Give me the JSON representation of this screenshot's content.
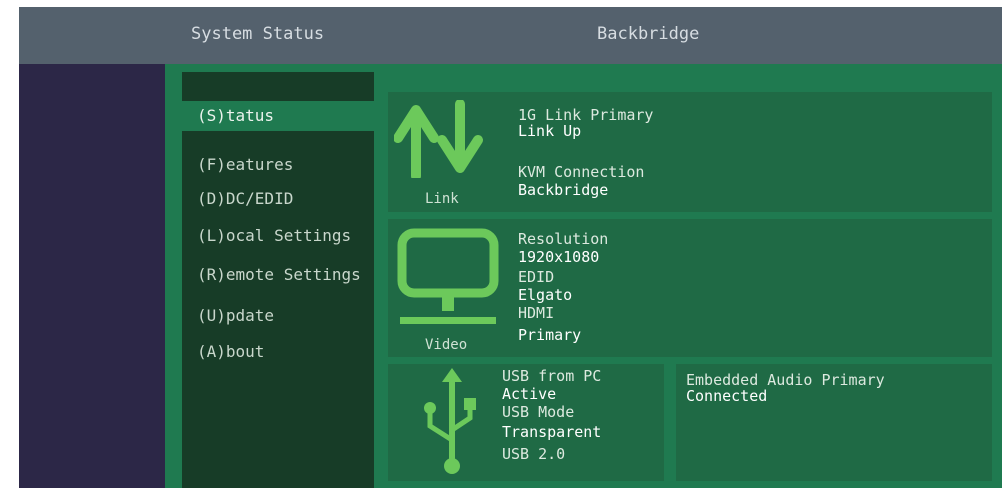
{
  "header": {
    "left_title": "System Status",
    "right_title": "Backbridge"
  },
  "menu": {
    "items": [
      {
        "label": "(S)tatus",
        "active": true
      },
      {
        "label": "(F)eatures",
        "active": false
      },
      {
        "label": "(D)DC/EDID",
        "active": false
      },
      {
        "label": "(L)ocal  Settings",
        "active": false
      },
      {
        "label": "(R)emote Settings",
        "active": false
      },
      {
        "label": "(U)pdate",
        "active": false
      },
      {
        "label": "(A)bout",
        "active": false
      }
    ]
  },
  "status": {
    "link": {
      "icon": "up-down-arrows-icon",
      "caption": "Link",
      "rows": [
        {
          "label": "1G Link Primary",
          "value": "Link Up"
        },
        {
          "label": "KVM Connection",
          "value": "Backbridge"
        }
      ]
    },
    "video": {
      "icon": "monitor-icon",
      "caption": "Video",
      "rows": [
        {
          "label": "Resolution",
          "value": "1920x1080"
        },
        {
          "label": "EDID",
          "value": "Elgato"
        },
        {
          "label": "HDMI",
          "value": "Primary"
        }
      ]
    },
    "usb": {
      "icon": "usb-icon",
      "rows": [
        {
          "label": "USB from PC",
          "value": "Active"
        },
        {
          "label": "USB Mode",
          "value": "Transparent"
        },
        {
          "label": "USB 2.0",
          "value": ""
        }
      ]
    },
    "audio": {
      "label": "Embedded Audio Primary",
      "value": "Connected"
    }
  },
  "colors": {
    "accent_green": "#6cc95b",
    "panel_green": "#1f6a45",
    "menu_dark": "#173c27",
    "header_gray": "#54616d"
  }
}
